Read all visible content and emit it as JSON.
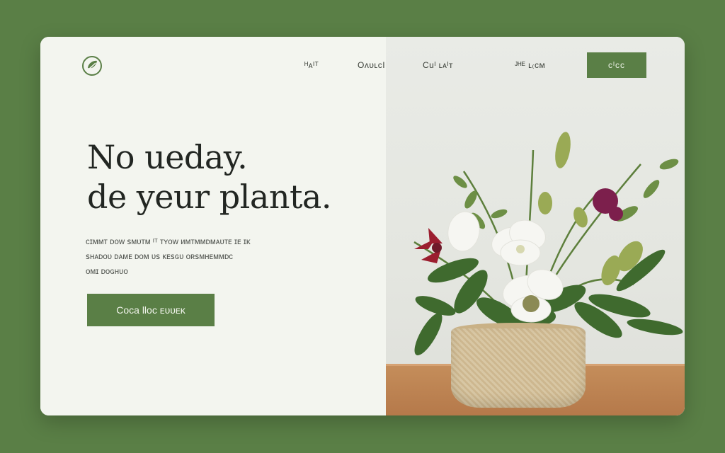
{
  "nav": {
    "items": [
      {
        "label": "ᴴᴀᴵᵀ"
      },
      {
        "label": "OʌᴜʟcI"
      },
      {
        "label": "Cuᴵ ʟᴀᴵᴛ"
      },
      {
        "label": "ᴶᴴᴱ ʟ₍ᴄᴍ"
      }
    ],
    "cta_label": "ᴄᴵᴄᴄ"
  },
  "hero": {
    "headline_line1": "No ueday.",
    "headline_line2": "de yeur planta.",
    "body_line1": "ᴄɪᴍᴍᴛ ᴅᴏᴡ ꜱᴍᴜᴛᴍ ᴵᵀ ᴛʏᴏᴡ ᴎᴍᴛᴍᴍᴅᴍᴀᴜᴛᴇ ɪᴇ ɪᴋ",
    "body_line2": "ꜱʜᴀᴅᴏᴜ ᴅᴀᴍᴇ ᴅᴏᴍ ᴜꜱ ᴋᴇꜱɢᴜ ᴏʀꜱᴍʜᴇᴍᴍᴅᴄ",
    "body_line3": "ᴏᴍɪ ᴅᴏɢʜᴜᴏ",
    "cta_label": "Coca lloᴄ ᴇᴜᴜᴇᴋ"
  },
  "colors": {
    "brand": "#5a7f46",
    "background": "#f3f5ef",
    "text": "#222622"
  },
  "icons": {
    "logo": "leaf-logo-icon"
  }
}
